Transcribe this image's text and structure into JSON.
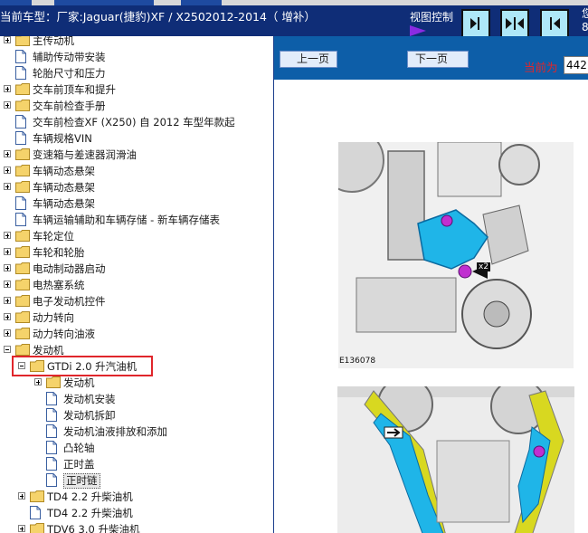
{
  "header": {
    "title": "当前车型：厂家:Jaguar(捷豹)XF / X2502012-2014（ 增补）",
    "view_control": "视图控制",
    "right_clip": [
      "您",
      "8"
    ]
  },
  "tree": {
    "items": [
      {
        "label": "主传动机",
        "icon": "folder",
        "expander": "plus"
      },
      {
        "label": "辅助传动带安装",
        "icon": "document",
        "expander": "none"
      },
      {
        "label": "轮胎尺寸和压力",
        "icon": "document",
        "expander": "none"
      },
      {
        "label": "交车前顶车和提升",
        "icon": "folder",
        "expander": "plus"
      },
      {
        "label": "交车前检查手册",
        "icon": "folder",
        "expander": "plus"
      },
      {
        "label": "交车前检查XF (X250) 自 2012 车型年款起",
        "icon": "document",
        "expander": "none"
      },
      {
        "label": "车辆规格VIN",
        "icon": "document",
        "expander": "none"
      },
      {
        "label": "变速箱与差速器润滑油",
        "icon": "folder",
        "expander": "plus"
      },
      {
        "label": "车辆动态悬架",
        "icon": "folder",
        "expander": "plus"
      },
      {
        "label": "车辆动态悬架",
        "icon": "folder",
        "expander": "plus"
      },
      {
        "label": "车辆动态悬架",
        "icon": "document",
        "expander": "none"
      },
      {
        "label": "车辆运输辅助和车辆存储 - 新车辆存储表",
        "icon": "document",
        "expander": "none"
      },
      {
        "label": "车轮定位",
        "icon": "folder",
        "expander": "plus"
      },
      {
        "label": "车轮和轮胎",
        "icon": "folder",
        "expander": "plus"
      },
      {
        "label": "电动制动器启动",
        "icon": "folder",
        "expander": "plus"
      },
      {
        "label": "电热塞系统",
        "icon": "folder",
        "expander": "plus"
      },
      {
        "label": "电子发动机控件",
        "icon": "folder",
        "expander": "plus"
      },
      {
        "label": "动力转向",
        "icon": "folder",
        "expander": "plus"
      },
      {
        "label": "动力转向油液",
        "icon": "folder",
        "expander": "plus"
      },
      {
        "label": "发动机",
        "icon": "folder",
        "expander": "minus"
      },
      {
        "label": "GTDi 2.0 升汽油机",
        "icon": "folder-open",
        "expander": "minus"
      },
      {
        "label": "发动机",
        "icon": "folder",
        "expander": "plus"
      },
      {
        "label": "发动机安装",
        "icon": "document",
        "expander": "none"
      },
      {
        "label": "发动机拆卸",
        "icon": "document",
        "expander": "none"
      },
      {
        "label": "发动机油液排放和添加",
        "icon": "document",
        "expander": "none"
      },
      {
        "label": "凸轮轴",
        "icon": "document",
        "expander": "none"
      },
      {
        "label": "正时盖",
        "icon": "document",
        "expander": "none"
      },
      {
        "label": "正时链",
        "icon": "document",
        "expander": "none"
      },
      {
        "label": "TD4 2.2 升柴油机",
        "icon": "folder",
        "expander": "plus"
      },
      {
        "label": "TD4 2.2 升柴油机",
        "icon": "document",
        "expander": "none"
      },
      {
        "label": "TDV6 3.0 升柴油机",
        "icon": "folder",
        "expander": "plus"
      }
    ],
    "selected_index": 27,
    "highlighted_index": 20
  },
  "viewer": {
    "prev_label": "上一页",
    "next_label": "下一页",
    "current_label": "当前为",
    "page_value": "442",
    "figure_label": "E136078",
    "callout": "x2"
  },
  "colors": {
    "header_bg": "#0f2d77",
    "viewer_bar_bg": "#0d5ea8",
    "highlight_border": "#e0262b",
    "tool_blue": "#1fb5e8",
    "fastener_magenta": "#c030d0",
    "guide_yellow": "#d8d820"
  },
  "icons": [
    "view-left-panel-icon",
    "view-split-icon",
    "view-right-panel-icon",
    "purple-arrow-icon",
    "folder-icon",
    "document-icon"
  ]
}
